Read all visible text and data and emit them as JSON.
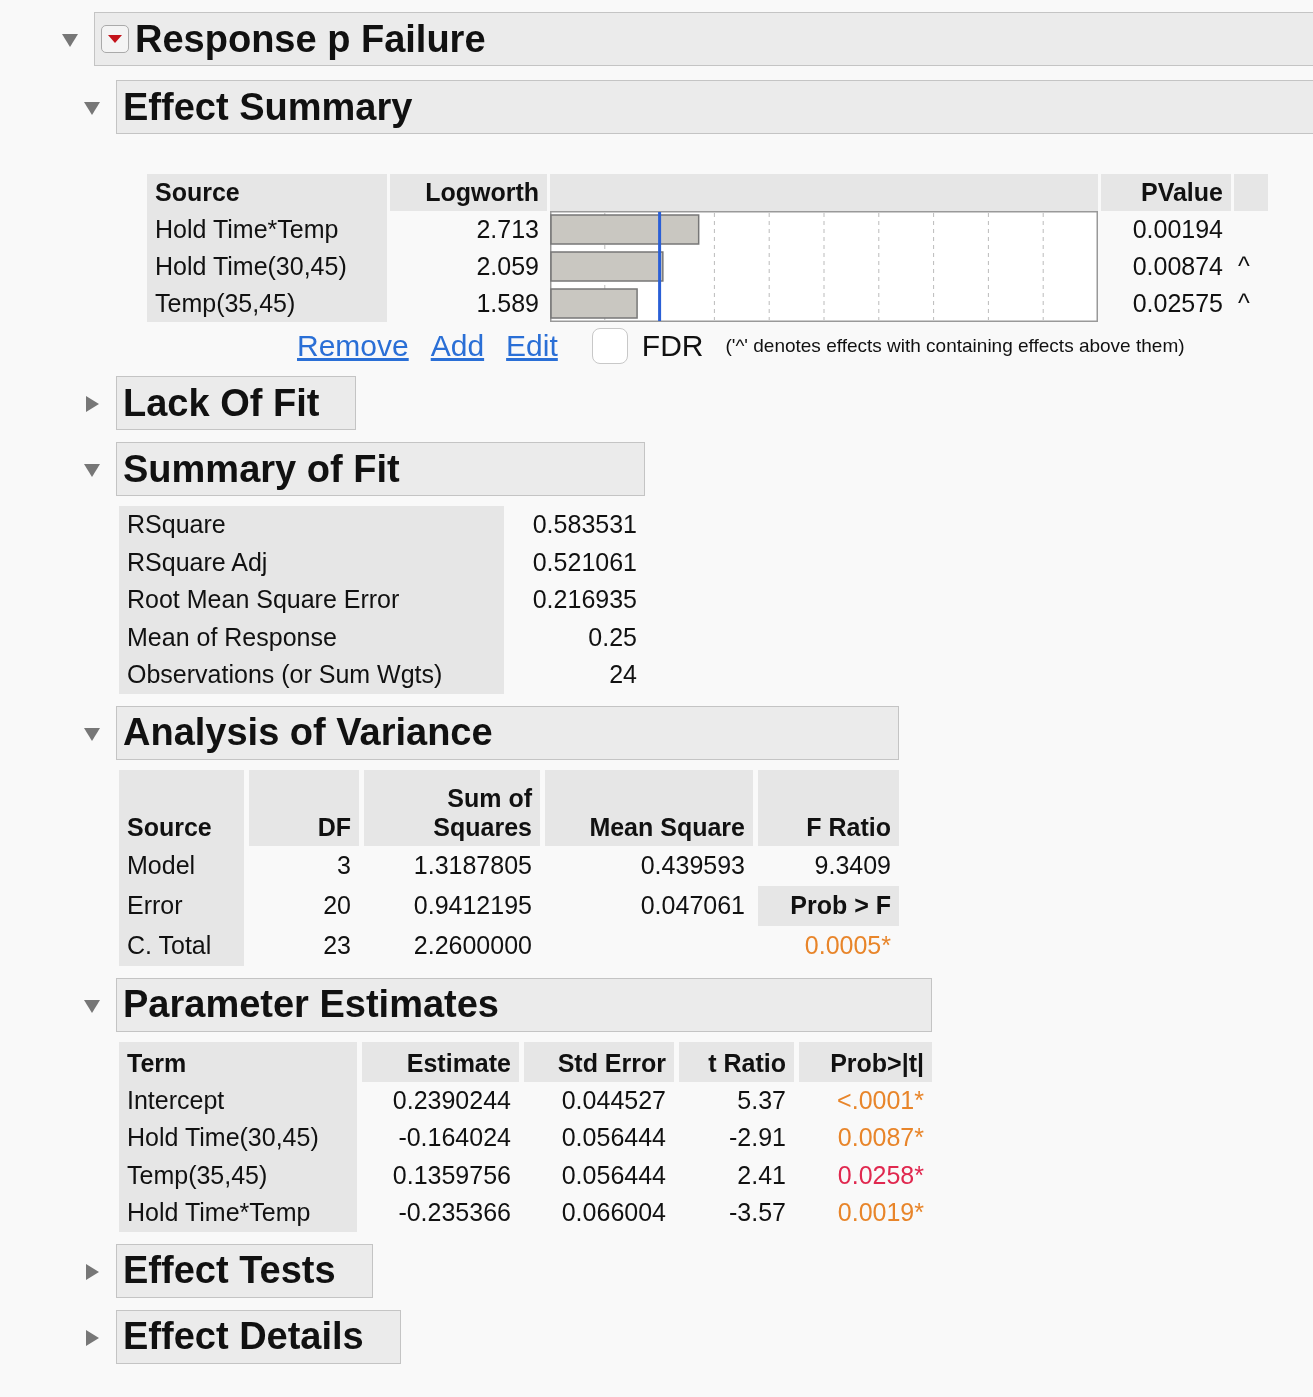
{
  "report": {
    "title": "Response p Failure",
    "expanded": true
  },
  "sections": [
    {
      "kind": "effect_summary",
      "title": "Effect Summary",
      "expanded": true,
      "columns": [
        "Source",
        "Logworth",
        "PValue"
      ],
      "rows": [
        {
          "source": "Hold Time*Temp",
          "logworth": "2.713",
          "level": 0.2713,
          "pvalue": "0.00194"
        },
        {
          "source": "Hold Time(30,45)",
          "logworth": "2.059",
          "level": 0.2059,
          "pvalue": "0.00874",
          "flag": "^"
        },
        {
          "source": "Temp(35,45)",
          "logworth": "1.589",
          "level": 0.1589,
          "pvalue": "0.02575",
          "flag": "^"
        }
      ],
      "actions": [
        "Remove",
        "Add",
        "Edit"
      ],
      "fdr": {
        "label": "FDR",
        "checked": false
      },
      "note": "('^' denotes effects with containing effects above them)"
    },
    {
      "kind": "plain",
      "title": "Lack Of Fit",
      "expanded": false
    },
    {
      "kind": "fit_summary",
      "title": "Summary of Fit",
      "expanded": true,
      "rows": [
        {
          "label": "RSquare",
          "value": "0.583531"
        },
        {
          "label": "RSquare Adj",
          "value": "0.521061"
        },
        {
          "label": "Root Mean Square Error",
          "value": "0.216935"
        },
        {
          "label": "Mean of Response",
          "value": "0.25"
        },
        {
          "label": "Observations (or Sum Wgts)",
          "value": "24"
        }
      ]
    },
    {
      "kind": "anova",
      "title": "Analysis of Variance",
      "expanded": true,
      "columns": [
        "Source",
        "DF",
        "Sum of Squares",
        "Mean Square",
        "F Ratio"
      ],
      "rows": [
        {
          "source": "Model",
          "df": "3",
          "ss": "1.3187805",
          "ms": "0.439593",
          "last": {
            "kind": "value",
            "text": "9.3409"
          }
        },
        {
          "source": "Error",
          "df": "20",
          "ss": "0.9412195",
          "ms": "0.047061",
          "last": {
            "kind": "label",
            "text": "Prob > F"
          }
        },
        {
          "source": "C. Total",
          "df": "23",
          "ss": "2.2600000",
          "last": {
            "kind": "pvalue",
            "text": "0.0005*",
            "color": "#e8852a"
          }
        }
      ]
    },
    {
      "kind": "estimates",
      "title": "Parameter Estimates",
      "expanded": true,
      "columns": [
        "Term",
        "Estimate",
        "Std Error",
        "t Ratio",
        "Prob>|t|"
      ],
      "rows": [
        {
          "term": "Intercept",
          "estimate": "0.2390244",
          "stderr": "0.044527",
          "t": "5.37",
          "p": "<.0001*",
          "color": "#e8852a"
        },
        {
          "term": "Hold Time(30,45)",
          "estimate": "-0.164024",
          "stderr": "0.056444",
          "t": "-2.91",
          "p": "0.0087*",
          "color": "#e8852a"
        },
        {
          "term": "Temp(35,45)",
          "estimate": "0.1359756",
          "stderr": "0.056444",
          "t": "2.41",
          "p": "0.0258*",
          "color": "#e0284f"
        },
        {
          "term": "Hold Time*Temp",
          "estimate": "-0.235366",
          "stderr": "0.066004",
          "t": "-3.57",
          "p": "0.0019*",
          "color": "#e8852a"
        }
      ]
    },
    {
      "kind": "plain",
      "title": "Effect Tests",
      "expanded": false
    },
    {
      "kind": "plain",
      "title": "Effect Details",
      "expanded": false
    }
  ]
}
